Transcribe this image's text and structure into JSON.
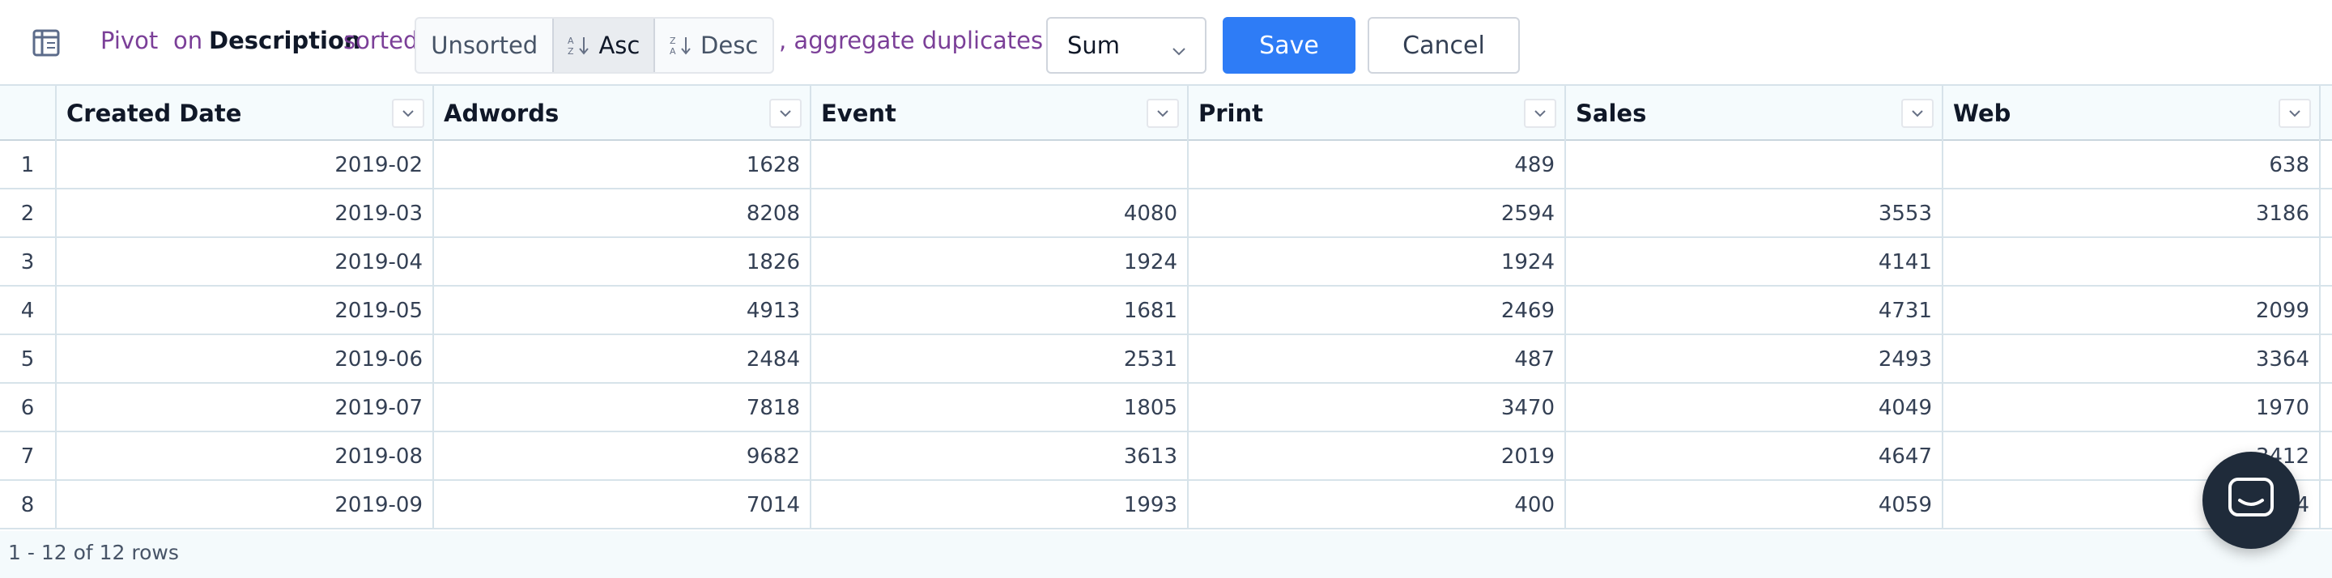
{
  "toolbar": {
    "pivot_label": "Pivot",
    "on_label": "on",
    "pivot_column": "Description",
    "sorted_label": "sorted",
    "sort_options": [
      "Unsorted",
      "Asc",
      "Desc"
    ],
    "sort_selected": "Asc",
    "aggregate_label": ", aggregate duplicates by",
    "aggregate_value": "Sum",
    "save_label": "Save",
    "cancel_label": "Cancel"
  },
  "table": {
    "columns": [
      "Created Date",
      "Adwords",
      "Event",
      "Print",
      "Sales",
      "Web"
    ],
    "rows": [
      {
        "n": "1",
        "cells": [
          "2019-02",
          "1628",
          "",
          "489",
          "",
          "638"
        ]
      },
      {
        "n": "2",
        "cells": [
          "2019-03",
          "8208",
          "4080",
          "2594",
          "3553",
          "3186"
        ]
      },
      {
        "n": "3",
        "cells": [
          "2019-04",
          "1826",
          "1924",
          "1924",
          "4141",
          ""
        ]
      },
      {
        "n": "4",
        "cells": [
          "2019-05",
          "4913",
          "1681",
          "2469",
          "4731",
          "2099"
        ]
      },
      {
        "n": "5",
        "cells": [
          "2019-06",
          "2484",
          "2531",
          "487",
          "2493",
          "3364"
        ]
      },
      {
        "n": "6",
        "cells": [
          "2019-07",
          "7818",
          "1805",
          "3470",
          "4049",
          "1970"
        ]
      },
      {
        "n": "7",
        "cells": [
          "2019-08",
          "9682",
          "3613",
          "2019",
          "4647",
          "3412"
        ]
      },
      {
        "n": "8",
        "cells": [
          "2019-09",
          "7014",
          "1993",
          "400",
          "4059",
          "3364"
        ]
      }
    ]
  },
  "footer": {
    "row_count": "1 - 12 of 12 rows"
  },
  "colors": {
    "accent": "#2e7cf6",
    "purple": "#7b3f98",
    "chat": "#1f2b3a"
  }
}
